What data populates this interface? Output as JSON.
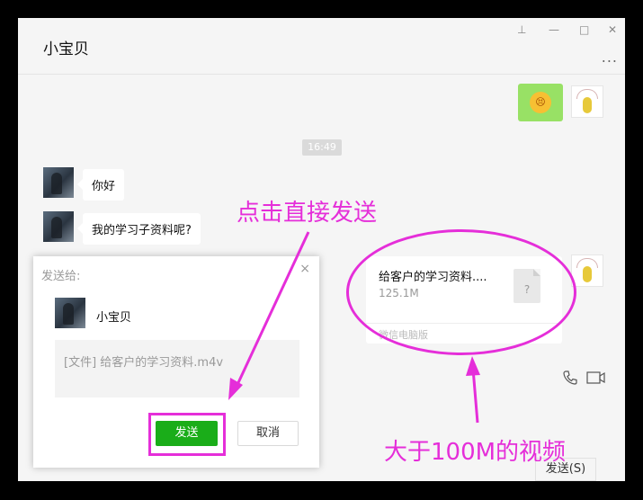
{
  "window": {
    "title": "小宝贝",
    "controls": {
      "pin": "⊥",
      "minimize": "—",
      "maximize": "□",
      "close": "✕"
    },
    "more": "..."
  },
  "messages": {
    "sticker_emoji": "😣",
    "timestamp": "16:49",
    "greeting": "你好",
    "question": "我的学习子资料呢?",
    "file": {
      "name": "给客户的学习资料....",
      "size": "125.1M",
      "icon_glyph": "?",
      "source": "微信电脑版"
    }
  },
  "toolbar": {
    "call_icon": "phone-icon",
    "video_icon": "video-icon",
    "send_label": "发送(S)"
  },
  "dialog": {
    "title": "发送给:",
    "close": "×",
    "recipient": "小宝贝",
    "file_text": "[文件] 给客户的学习资料.m4v",
    "send_label": "发送",
    "cancel_label": "取消"
  },
  "annotations": {
    "click_note": "点击直接发送",
    "size_note": "大于100M的视频",
    "color": "#e52ed9"
  }
}
